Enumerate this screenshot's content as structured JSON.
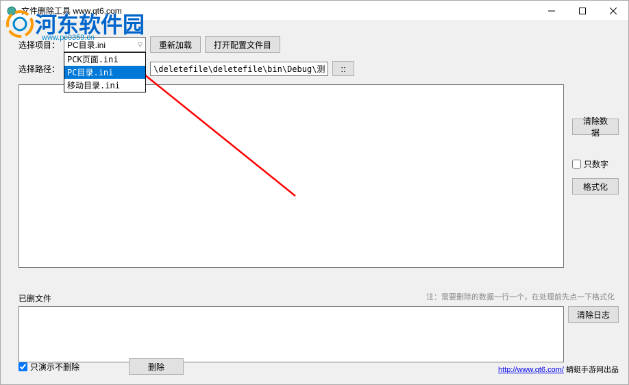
{
  "titlebar": {
    "title": "文件删除工具 www.qt6.com"
  },
  "watermark": {
    "main": "河东软件园",
    "sub": "www.pc0359.cn"
  },
  "labels": {
    "selectProject": "选择项目：",
    "selectPath": "选择路径：",
    "deletedFiles": "已删文件",
    "hint": "注：需要删除的数据一行一个，在处理前先点一下格式化"
  },
  "combo": {
    "selected": "PC目录.ini",
    "options": [
      "PCK页面.ini",
      "PC目录.ini",
      "移动目录.ini"
    ]
  },
  "buttons": {
    "reload": "重新加载",
    "openConfig": "打开配置文件目",
    "browse": "::",
    "clearData": "清除数据",
    "numbersOnly": "只数字",
    "format": "格式化",
    "clearLog": "清除日志",
    "demoOnly": "只演示不删除",
    "delete": "删除"
  },
  "path": {
    "value": "\\deletefile\\deletefile\\bin\\Debug\\测试"
  },
  "checkboxes": {
    "numbersOnly": false,
    "demoOnly": true
  },
  "footer": {
    "linkUrl": "http://www.qt6.com/",
    "linkText": "http://www.qt6.com/",
    "suffix": " 蜻蜓手游网出品"
  }
}
